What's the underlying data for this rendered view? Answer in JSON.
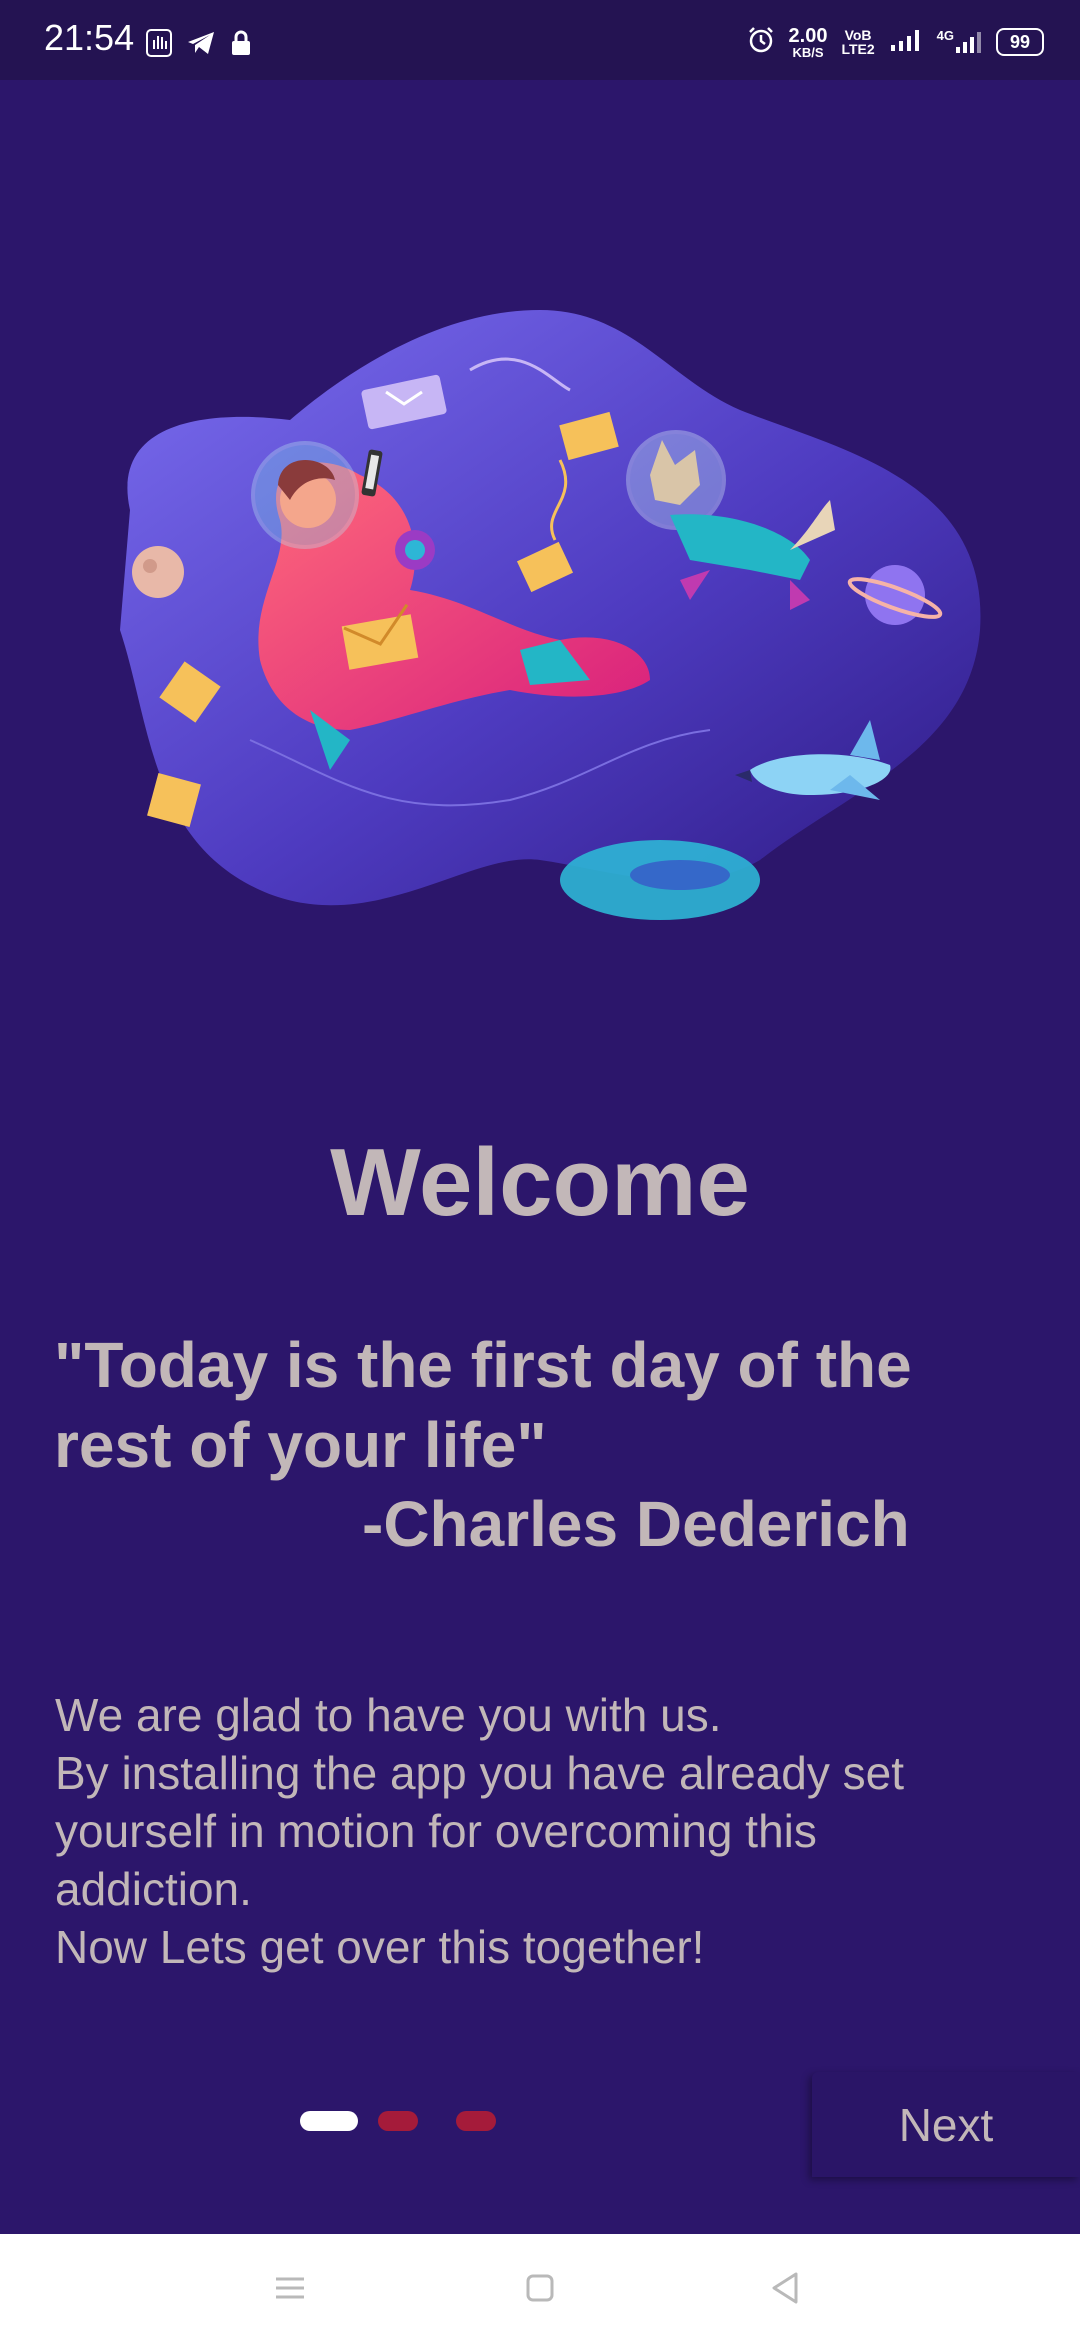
{
  "status_bar": {
    "time": "21:54",
    "net_speed_value": "2.00",
    "net_speed_unit": "KB/S",
    "volte_top": "VoB",
    "volte_bottom": "LTE2",
    "network_type": "4G",
    "battery_level": "99",
    "icons": [
      "hand-notification-icon",
      "telegram-icon",
      "lock-icon",
      "alarm-icon",
      "signal-icon",
      "signal-4g-icon",
      "battery-icon"
    ]
  },
  "onboarding": {
    "illustration": "astronaut-and-dog-in-space-illustration",
    "title": "Welcome",
    "quote_line1": "\"Today is the first day of the",
    "quote_line2": "rest of your life\"",
    "quote_author": "-Charles Dederich",
    "body_lines": [
      "We are glad to have you with us.",
      "By installing the app you have already set",
      "yourself in motion for overcoming this",
      "addiction.",
      "Now Lets get over this together!"
    ],
    "page_indicator": {
      "total": 3,
      "current": 1
    },
    "next_label": "Next"
  },
  "colors": {
    "background": "#2c166b",
    "status_bar": "#241352",
    "text": "#c2b7b8",
    "dot_active": "#ffffff",
    "dot_inactive": "#a51b3a"
  },
  "nav_bar": {
    "icons": [
      "menu-icon",
      "home-icon",
      "back-icon"
    ]
  }
}
